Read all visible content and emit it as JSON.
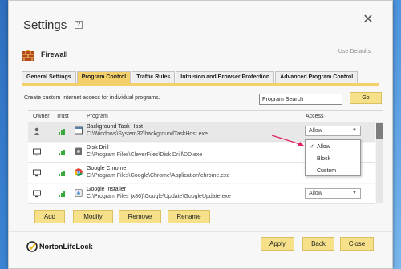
{
  "window": {
    "title": "Settings",
    "help_glyph": "?",
    "close_glyph": "✕"
  },
  "section": {
    "label": "Firewall",
    "defaults_link": "Use Defaults"
  },
  "tabs": [
    {
      "label": "General Settings",
      "active": false
    },
    {
      "label": "Program Control",
      "active": true
    },
    {
      "label": "Traffic Rules",
      "active": false
    },
    {
      "label": "Intrusion and Browser Protection",
      "active": false
    },
    {
      "label": "Advanced Program Control",
      "active": false
    }
  ],
  "intro_text": "Create custom Internet access for individual programs.",
  "search": {
    "value": "Program Search",
    "go_label": "Go"
  },
  "table": {
    "headers": {
      "owner": "Owner",
      "trust": "Trust",
      "program": "Program",
      "access": "Access"
    },
    "rows": [
      {
        "owner_icon": "user-icon",
        "trust_icon": "trust-bars-icon",
        "program_icon": "app-window-icon",
        "name": "Background Task Host",
        "path": "C:\\Windows\\System32\\backgroundTaskHost.exe",
        "access": "Allow"
      },
      {
        "owner_icon": "computer-icon",
        "trust_icon": "trust-bars-icon",
        "program_icon": "disk-drill-icon",
        "name": "Disk Drill",
        "path": "C:\\Program Files\\CleverFiles\\Disk Drill\\DD.exe",
        "access": ""
      },
      {
        "owner_icon": "computer-icon",
        "trust_icon": "trust-bars-icon",
        "program_icon": "chrome-icon",
        "name": "Google Chrome",
        "path": "C:\\Program Files\\Google\\Chrome\\Application\\chrome.exe",
        "access": ""
      },
      {
        "owner_icon": "computer-icon",
        "trust_icon": "trust-bars-icon",
        "program_icon": "google-installer-icon",
        "name": "Google Installer",
        "path": "C:\\Program Files (x86)\\Google\\Update\\GoogleUpdate.exe",
        "access": "Allow"
      }
    ]
  },
  "dropdown": {
    "options": [
      {
        "label": "Allow",
        "checked": true,
        "check_glyph": "✓"
      },
      {
        "label": "Block",
        "checked": false,
        "check_glyph": ""
      },
      {
        "label": "Custom",
        "checked": false,
        "check_glyph": ""
      }
    ]
  },
  "actions": {
    "add": "Add",
    "modify": "Modify",
    "remove": "Remove",
    "rename": "Rename"
  },
  "footer": {
    "brand": "NortonLifeLock",
    "apply": "Apply",
    "back": "Back",
    "close": "Close"
  },
  "colors": {
    "accent": "#f4d06a",
    "button": "#f6e08a",
    "trust_green": "#3aa83a",
    "annotation_arrow": "#e0245e"
  }
}
